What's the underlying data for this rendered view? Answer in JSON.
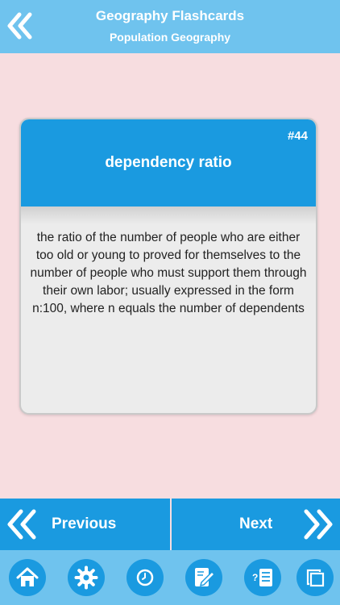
{
  "header": {
    "title": "Geography Flashcards",
    "subtitle": "Population Geography",
    "back_icon": "double-chevron-left-icon"
  },
  "card": {
    "number": "#44",
    "term": "dependency ratio",
    "definition": "the ratio of the number of people who are either too old or young to proved for themselves to the number of people who must support them through their own labor; usually expressed in the form n:100, where n equals the number of dependents"
  },
  "navigation": {
    "previous_label": "Previous",
    "next_label": "Next"
  },
  "toolbar": {
    "items": [
      {
        "icon": "home-icon"
      },
      {
        "icon": "gear-icon"
      },
      {
        "icon": "clock-icon"
      },
      {
        "icon": "edit-note-icon"
      },
      {
        "icon": "quiz-list-icon"
      },
      {
        "icon": "copy-icon"
      }
    ]
  },
  "colors": {
    "header": "#6fc3ee",
    "accent": "#1a9ae0",
    "background": "#f7dde0",
    "card": "#ececec"
  }
}
